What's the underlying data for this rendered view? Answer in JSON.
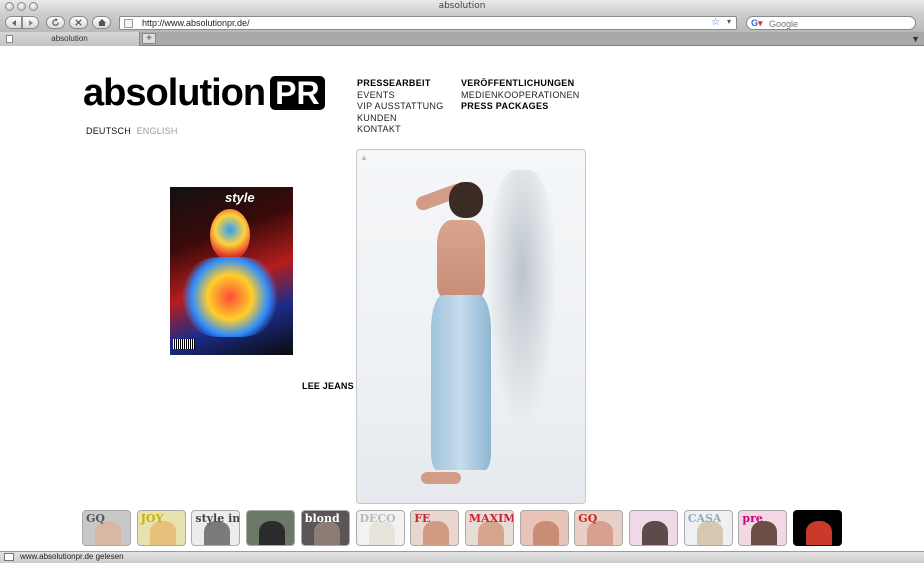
{
  "window": {
    "title": "absolution"
  },
  "toolbar": {
    "url": "http://www.absolutionpr.de/",
    "search_placeholder": "Google"
  },
  "tabs": [
    {
      "label": "absolution"
    }
  ],
  "site": {
    "logo": {
      "text": "absolution",
      "badge": "PR"
    },
    "languages": {
      "german": "DEUTSCH",
      "english": "ENGLISH"
    },
    "nav_left": [
      "PRESSEARBEIT",
      "EVENTS",
      "VIP AUSSTATTUNG",
      "KUNDEN",
      "KONTAKT"
    ],
    "nav_right": [
      "VERÖFFENTLICHUNGEN",
      "MEDIENKOOPERATIONEN",
      "PRESS PACKAGES"
    ],
    "caption": "LEE JEANS",
    "cover_title": "style"
  },
  "thumbnails": [
    {
      "title": "GQ",
      "color": "#c8c8c8",
      "fig": "#d9b7a2",
      "text": "#555"
    },
    {
      "title": "JOY",
      "color": "#e8e2b0",
      "fig": "#e7c07c",
      "text": "#c8b200"
    },
    {
      "title": "style in progress",
      "color": "#ececec",
      "fig": "#7a7a7a",
      "text": "#444"
    },
    {
      "title": "",
      "color": "#6b7a66",
      "fig": "#2b2b2b",
      "text": "#fff"
    },
    {
      "title": "blond",
      "color": "#5a5656",
      "fig": "#8d7c75",
      "text": "#fff"
    },
    {
      "title": "DECO",
      "color": "#f2f2f2",
      "fig": "#e8e4dc",
      "text": "#bbb"
    },
    {
      "title": "FE",
      "color": "#e9d7cf",
      "fig": "#d19b82",
      "text": "#c23"
    },
    {
      "title": "MAXIM",
      "color": "#e7dcd6",
      "fig": "#d5a58e",
      "text": "#c23"
    },
    {
      "title": "",
      "color": "#e9c4b6",
      "fig": "#c98d75",
      "text": "#a22"
    },
    {
      "title": "GQ",
      "color": "#e8cfc8",
      "fig": "#d8a08e",
      "text": "#d02020"
    },
    {
      "title": "",
      "color": "#f0d9e6",
      "fig": "#5e4a4a",
      "text": "#c06"
    },
    {
      "title": "CASA",
      "color": "#eef0f2",
      "fig": "#d7c8b2",
      "text": "#9ab"
    },
    {
      "title": "pre",
      "color": "#f1d8e2",
      "fig": "#6b4c46",
      "text": "#c07"
    },
    {
      "title": "",
      "color": "#000000",
      "fig": "#c93a2b",
      "text": "#fff"
    }
  ],
  "status": {
    "text": "www.absolutionpr.de gelesen"
  }
}
